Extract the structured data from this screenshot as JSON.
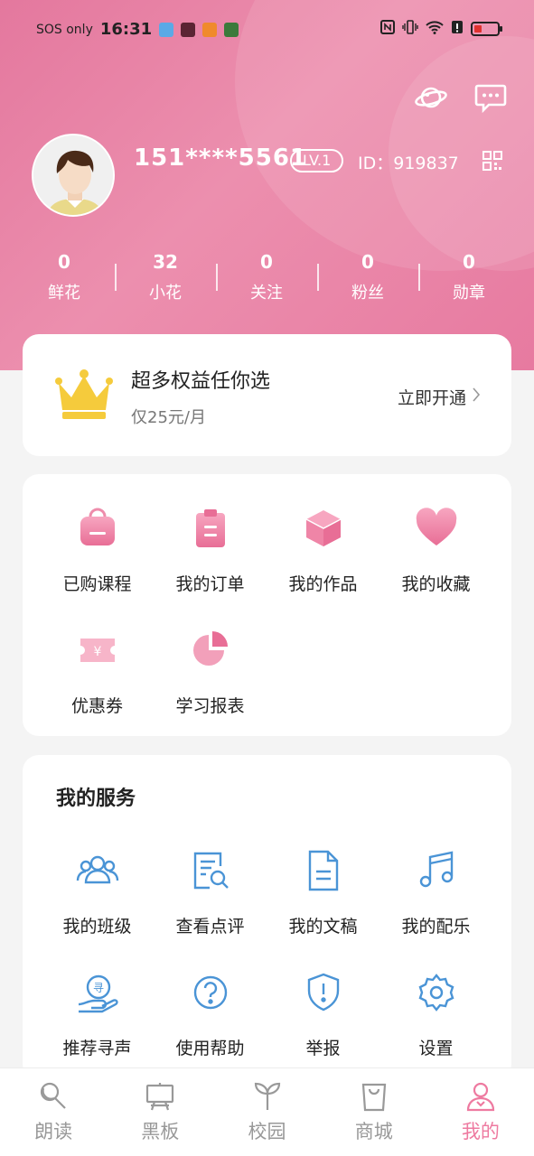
{
  "status_bar": {
    "carrier": "SOS only",
    "time": "16:31"
  },
  "profile": {
    "phone": "151****5561",
    "level": "LV.1",
    "id_text": "ID：919837"
  },
  "stats": [
    {
      "value": "0",
      "label": "鲜花"
    },
    {
      "value": "32",
      "label": "小花"
    },
    {
      "value": "0",
      "label": "关注"
    },
    {
      "value": "0",
      "label": "粉丝"
    },
    {
      "value": "0",
      "label": "勋章"
    }
  ],
  "vip": {
    "title": "超多权益任你选",
    "price": "仅25元/月",
    "action": "立即开通"
  },
  "quick_menu": [
    {
      "label": "已购课程",
      "icon": "bag-icon"
    },
    {
      "label": "我的订单",
      "icon": "clipboard-icon"
    },
    {
      "label": "我的作品",
      "icon": "box-icon"
    },
    {
      "label": "我的收藏",
      "icon": "heart-icon"
    },
    {
      "label": "优惠券",
      "icon": "coupon-icon"
    },
    {
      "label": "学习报表",
      "icon": "pie-chart-icon"
    }
  ],
  "services": {
    "title": "我的服务",
    "items": [
      {
        "label": "我的班级",
        "icon": "group-icon"
      },
      {
        "label": "查看点评",
        "icon": "review-icon"
      },
      {
        "label": "我的文稿",
        "icon": "document-icon"
      },
      {
        "label": "我的配乐",
        "icon": "music-icon"
      },
      {
        "label": "推荐寻声",
        "icon": "recommend-icon"
      },
      {
        "label": "使用帮助",
        "icon": "help-icon"
      },
      {
        "label": "举报",
        "icon": "report-icon"
      },
      {
        "label": "设置",
        "icon": "settings-icon"
      }
    ]
  },
  "tabs": [
    {
      "label": "朗读",
      "icon": "microphone-icon",
      "active": false
    },
    {
      "label": "黑板",
      "icon": "blackboard-icon",
      "active": false
    },
    {
      "label": "校园",
      "icon": "sprout-icon",
      "active": false
    },
    {
      "label": "商城",
      "icon": "shopping-bag-icon",
      "active": false
    },
    {
      "label": "我的",
      "icon": "person-icon",
      "active": true
    }
  ],
  "colors": {
    "header_pink": "#e77aa0",
    "accent_pink": "#ee7aa0",
    "service_blue": "#4a94d6",
    "crown_gold": "#f5cb3c"
  }
}
